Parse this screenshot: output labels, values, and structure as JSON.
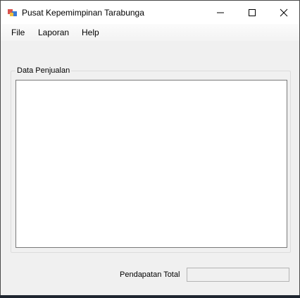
{
  "window": {
    "title": "Pusat Kepemimpinan Tarabunga"
  },
  "menu": {
    "items": [
      "File",
      "Laporan",
      "Help"
    ]
  },
  "sales_group": {
    "label": "Data Penjualan"
  },
  "total": {
    "label": "Pendapatan Total",
    "value": ""
  }
}
